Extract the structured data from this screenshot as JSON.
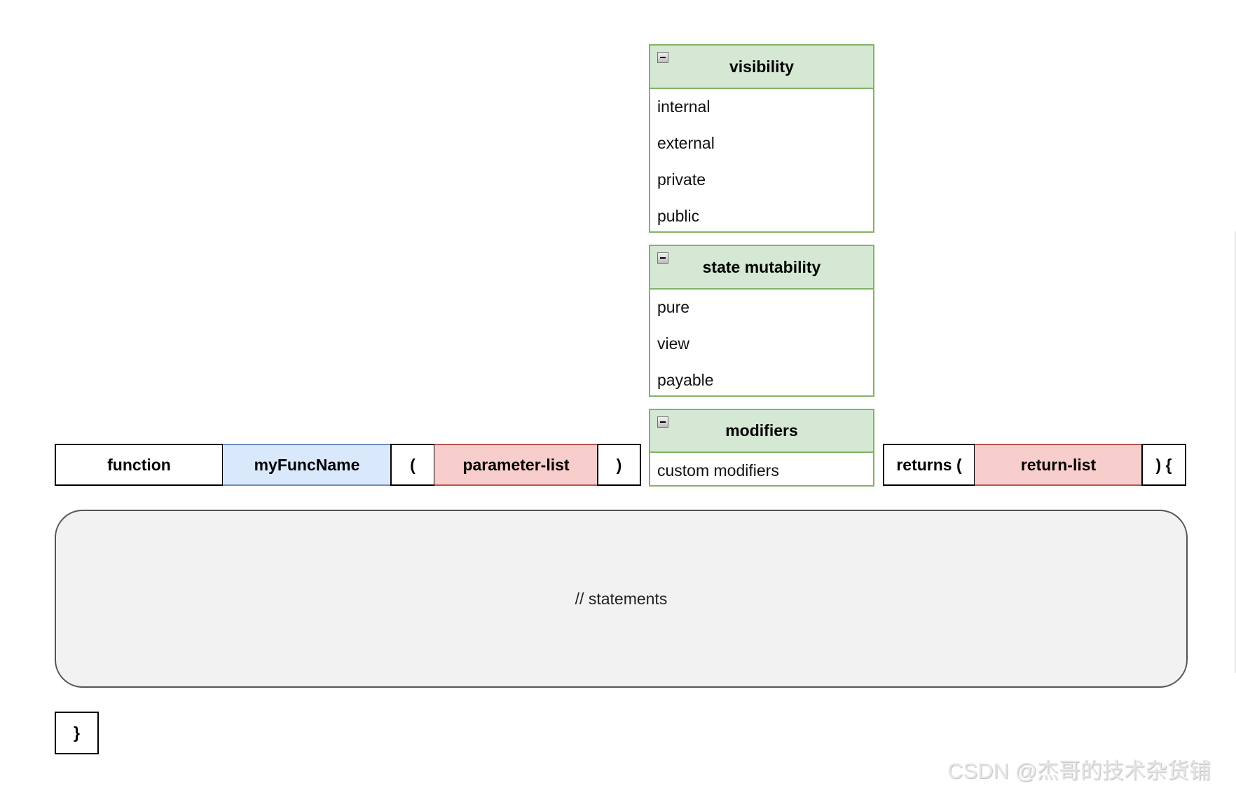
{
  "signature": {
    "keyword": "function",
    "name": "myFuncName",
    "open_paren": "(",
    "params": "parameter-list",
    "close_paren": ")",
    "returns_open": "returns (",
    "return_list": "return-list",
    "returns_close": ") {"
  },
  "panels": {
    "visibility": {
      "title": "visibility",
      "items": [
        "internal",
        "external",
        "private",
        "public"
      ]
    },
    "state_mutability": {
      "title": "state mutability",
      "items": [
        "pure",
        "view",
        "payable"
      ]
    },
    "modifiers": {
      "title": "modifiers",
      "items": [
        "custom modifiers"
      ]
    }
  },
  "body": {
    "statements": "// statements",
    "closing_brace": "}"
  },
  "colors": {
    "name_fill": "#dae8fc",
    "name_stroke": "#6c8ebf",
    "list_fill": "#f8cecc",
    "list_stroke": "#b85450",
    "panel_header_fill": "#d5e8d4",
    "panel_stroke": "#82b366",
    "statements_fill": "#f2f2f2"
  },
  "watermark": "CSDN @杰哥的技术杂货铺"
}
